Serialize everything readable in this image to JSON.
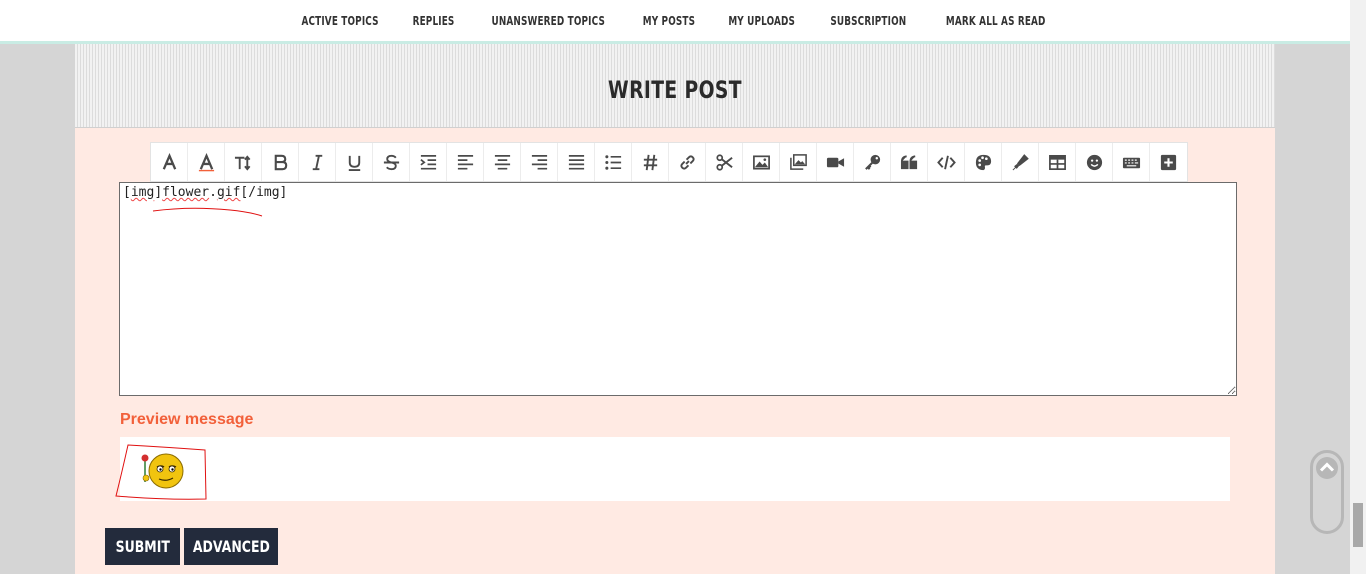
{
  "nav": {
    "items": [
      {
        "label": "Active topics"
      },
      {
        "label": "Replies"
      },
      {
        "label": "Unanswered topics"
      },
      {
        "label": "My posts"
      },
      {
        "label": "My uploads"
      },
      {
        "label": "Subscription"
      },
      {
        "label": "Mark all as read"
      }
    ]
  },
  "page": {
    "title": "WRITE POST"
  },
  "toolbar": {
    "buttons": [
      {
        "name": "font-icon"
      },
      {
        "name": "font-color-icon"
      },
      {
        "name": "font-size-icon"
      },
      {
        "name": "bold-icon"
      },
      {
        "name": "italic-icon"
      },
      {
        "name": "underline-icon"
      },
      {
        "name": "strikethrough-icon"
      },
      {
        "name": "indent-icon"
      },
      {
        "name": "align-left-icon"
      },
      {
        "name": "align-center-icon"
      },
      {
        "name": "align-right-icon"
      },
      {
        "name": "justify-icon"
      },
      {
        "name": "list-icon"
      },
      {
        "name": "hashtag-icon"
      },
      {
        "name": "link-icon"
      },
      {
        "name": "cut-icon"
      },
      {
        "name": "image-icon"
      },
      {
        "name": "gallery-icon"
      },
      {
        "name": "video-icon"
      },
      {
        "name": "key-icon"
      },
      {
        "name": "quote-icon"
      },
      {
        "name": "code-icon"
      },
      {
        "name": "palette-icon"
      },
      {
        "name": "highlighter-icon"
      },
      {
        "name": "table-icon"
      },
      {
        "name": "emoji-icon"
      },
      {
        "name": "keyboard-icon"
      },
      {
        "name": "plus-icon"
      }
    ]
  },
  "editor": {
    "content_parts": [
      "[",
      "img",
      "]",
      "flower",
      ".",
      "gif",
      "[/img]"
    ]
  },
  "preview": {
    "label": "Preview message"
  },
  "actions": {
    "submit": "SUBMIT",
    "advanced": "ADVANCED"
  },
  "colors": {
    "accent": "#f2603a",
    "button": "#232b3c",
    "panel": "#ffeae3",
    "annotation": "#e01010"
  }
}
